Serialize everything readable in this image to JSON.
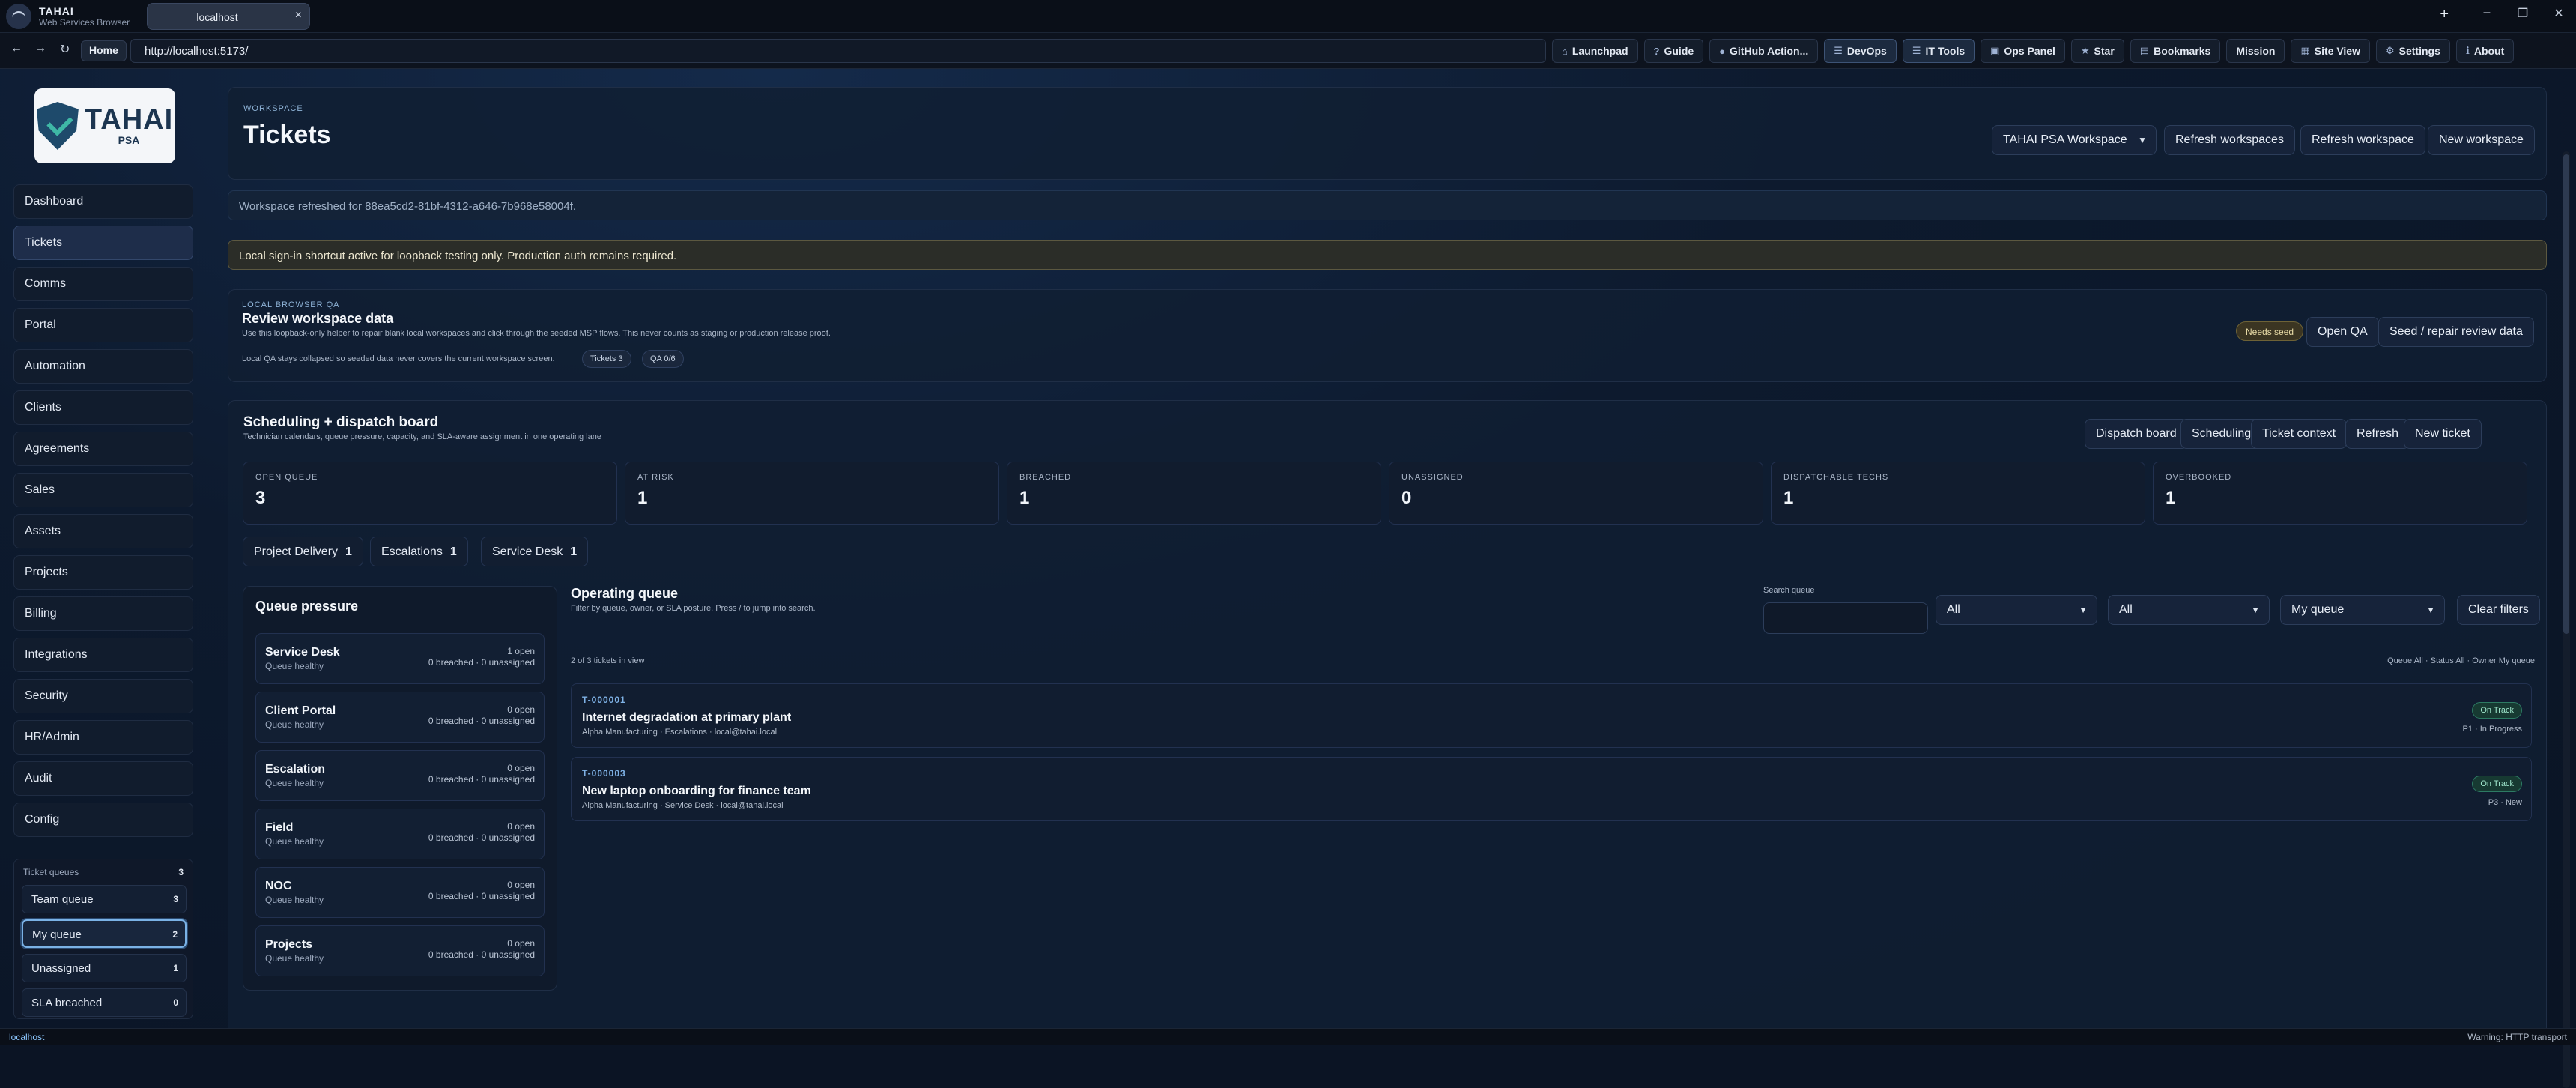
{
  "browser": {
    "brand": "TAHAI",
    "brand_sub": "Web Services Browser",
    "tab_title": "localhost",
    "url": "http://localhost:5173/",
    "home_label": "Home",
    "toolbar": [
      {
        "icon": "launchpad-icon",
        "glyph": "⌂",
        "label": "Launchpad"
      },
      {
        "icon": "guide-icon",
        "glyph": "?",
        "label": "Guide"
      },
      {
        "icon": "github-icon",
        "glyph": "●",
        "label": "GitHub Action..."
      },
      {
        "icon": "menu-icon",
        "glyph": "☰",
        "label": "DevOps"
      },
      {
        "icon": "menu-icon",
        "glyph": "☰",
        "label": "IT Tools"
      },
      {
        "icon": "panel-icon",
        "glyph": "▣",
        "label": "Ops Panel"
      },
      {
        "icon": "star-icon",
        "glyph": "★",
        "label": "Star"
      },
      {
        "icon": "bookmark-icon",
        "glyph": "▤",
        "label": "Bookmarks"
      },
      {
        "icon": "",
        "glyph": "",
        "label": "Mission"
      },
      {
        "icon": "grid-icon",
        "glyph": "▦",
        "label": "Site View"
      },
      {
        "icon": "gear-icon",
        "glyph": "⚙",
        "label": "Settings"
      },
      {
        "icon": "info-icon",
        "glyph": "ℹ",
        "label": "About"
      }
    ]
  },
  "logo": {
    "name": "TAHAI",
    "sub": "PSA"
  },
  "sidebar": {
    "items": [
      "Dashboard",
      "Tickets",
      "Comms",
      "Portal",
      "Automation",
      "Clients",
      "Agreements",
      "Sales",
      "Assets",
      "Projects",
      "Billing",
      "Integrations",
      "Security",
      "HR/Admin",
      "Audit",
      "Config"
    ],
    "active": "Tickets",
    "queues_title": "Ticket queues",
    "queues_count": "3",
    "queues": [
      {
        "label": "Team queue",
        "count": "3"
      },
      {
        "label": "My queue",
        "count": "2"
      },
      {
        "label": "Unassigned",
        "count": "1"
      },
      {
        "label": "SLA breached",
        "count": "0"
      }
    ]
  },
  "header": {
    "eyebrow": "WORKSPACE",
    "title": "Tickets",
    "workspace_select": "TAHAI PSA Workspace",
    "btn_refresh_workspaces": "Refresh workspaces",
    "btn_refresh_workspace": "Refresh workspace",
    "btn_new_workspace": "New workspace"
  },
  "notices": {
    "refresh": "Workspace refreshed for 88ea5cd2-81bf-4312-a646-7b968e58004f.",
    "signin": "Local sign-in shortcut active for loopback testing only. Production auth remains required."
  },
  "qa": {
    "eyebrow": "LOCAL BROWSER QA",
    "title": "Review workspace data",
    "desc": "Use this loopback-only helper to repair blank local workspaces and click through the seeded MSP flows. This never counts as staging or production release proof.",
    "note": "Local QA stays collapsed so seeded data never covers the current workspace screen.",
    "pill_tickets": "Tickets 3",
    "pill_qa": "QA 0/6",
    "badge": "Needs seed",
    "btn_open": "Open QA",
    "btn_seed": "Seed / repair review data"
  },
  "board": {
    "title": "Scheduling + dispatch board",
    "subtitle": "Technician calendars, queue pressure, capacity, and SLA-aware assignment in one operating lane",
    "buttons": [
      "Dispatch board",
      "Scheduling",
      "Ticket context",
      "Refresh",
      "New ticket"
    ],
    "stats": [
      {
        "label": "OPEN QUEUE",
        "value": "3"
      },
      {
        "label": "AT RISK",
        "value": "1"
      },
      {
        "label": "BREACHED",
        "value": "1"
      },
      {
        "label": "UNASSIGNED",
        "value": "0"
      },
      {
        "label": "DISPATCHABLE TECHS",
        "value": "1"
      },
      {
        "label": "OVERBOOKED",
        "value": "1"
      }
    ],
    "chips": [
      {
        "label": "Project Delivery",
        "count": "1"
      },
      {
        "label": "Escalations",
        "count": "1"
      },
      {
        "label": "Service Desk",
        "count": "1"
      }
    ]
  },
  "pressure": {
    "title": "Queue pressure",
    "queues": [
      {
        "name": "Service Desk",
        "status": "Queue healthy",
        "open": "1 open",
        "detail": "0 breached · 0 unassigned"
      },
      {
        "name": "Client Portal",
        "status": "Queue healthy",
        "open": "0 open",
        "detail": "0 breached · 0 unassigned"
      },
      {
        "name": "Escalation",
        "status": "Queue healthy",
        "open": "0 open",
        "detail": "0 breached · 0 unassigned"
      },
      {
        "name": "Field",
        "status": "Queue healthy",
        "open": "0 open",
        "detail": "0 breached · 0 unassigned"
      },
      {
        "name": "NOC",
        "status": "Queue healthy",
        "open": "0 open",
        "detail": "0 breached · 0 unassigned"
      },
      {
        "name": "Projects",
        "status": "Queue healthy",
        "open": "0 open",
        "detail": "0 breached · 0 unassigned"
      }
    ]
  },
  "operating": {
    "title": "Operating queue",
    "subtitle": "Filter by queue, owner, or SLA posture. Press / to jump into search.",
    "search_label": "Search queue",
    "search_value": "",
    "filter_queue": "All",
    "filter_status": "All",
    "filter_owner": "My queue",
    "btn_clear": "Clear filters",
    "count_text": "2 of 3 tickets in view",
    "filter_summary": "Queue All · Status All · Owner My queue",
    "tickets": [
      {
        "id": "T-000001",
        "title": "Internet degradation at primary plant",
        "meta": "Alpha Manufacturing · Escalations · local@tahai.local",
        "sla": "On Track",
        "priority": "P1 · In Progress"
      },
      {
        "id": "T-000003",
        "title": "New laptop onboarding for finance team",
        "meta": "Alpha Manufacturing · Service Desk · local@tahai.local",
        "sla": "On Track",
        "priority": "P3 · New"
      }
    ]
  },
  "status": {
    "left": "localhost",
    "right": "Warning: HTTP transport"
  }
}
